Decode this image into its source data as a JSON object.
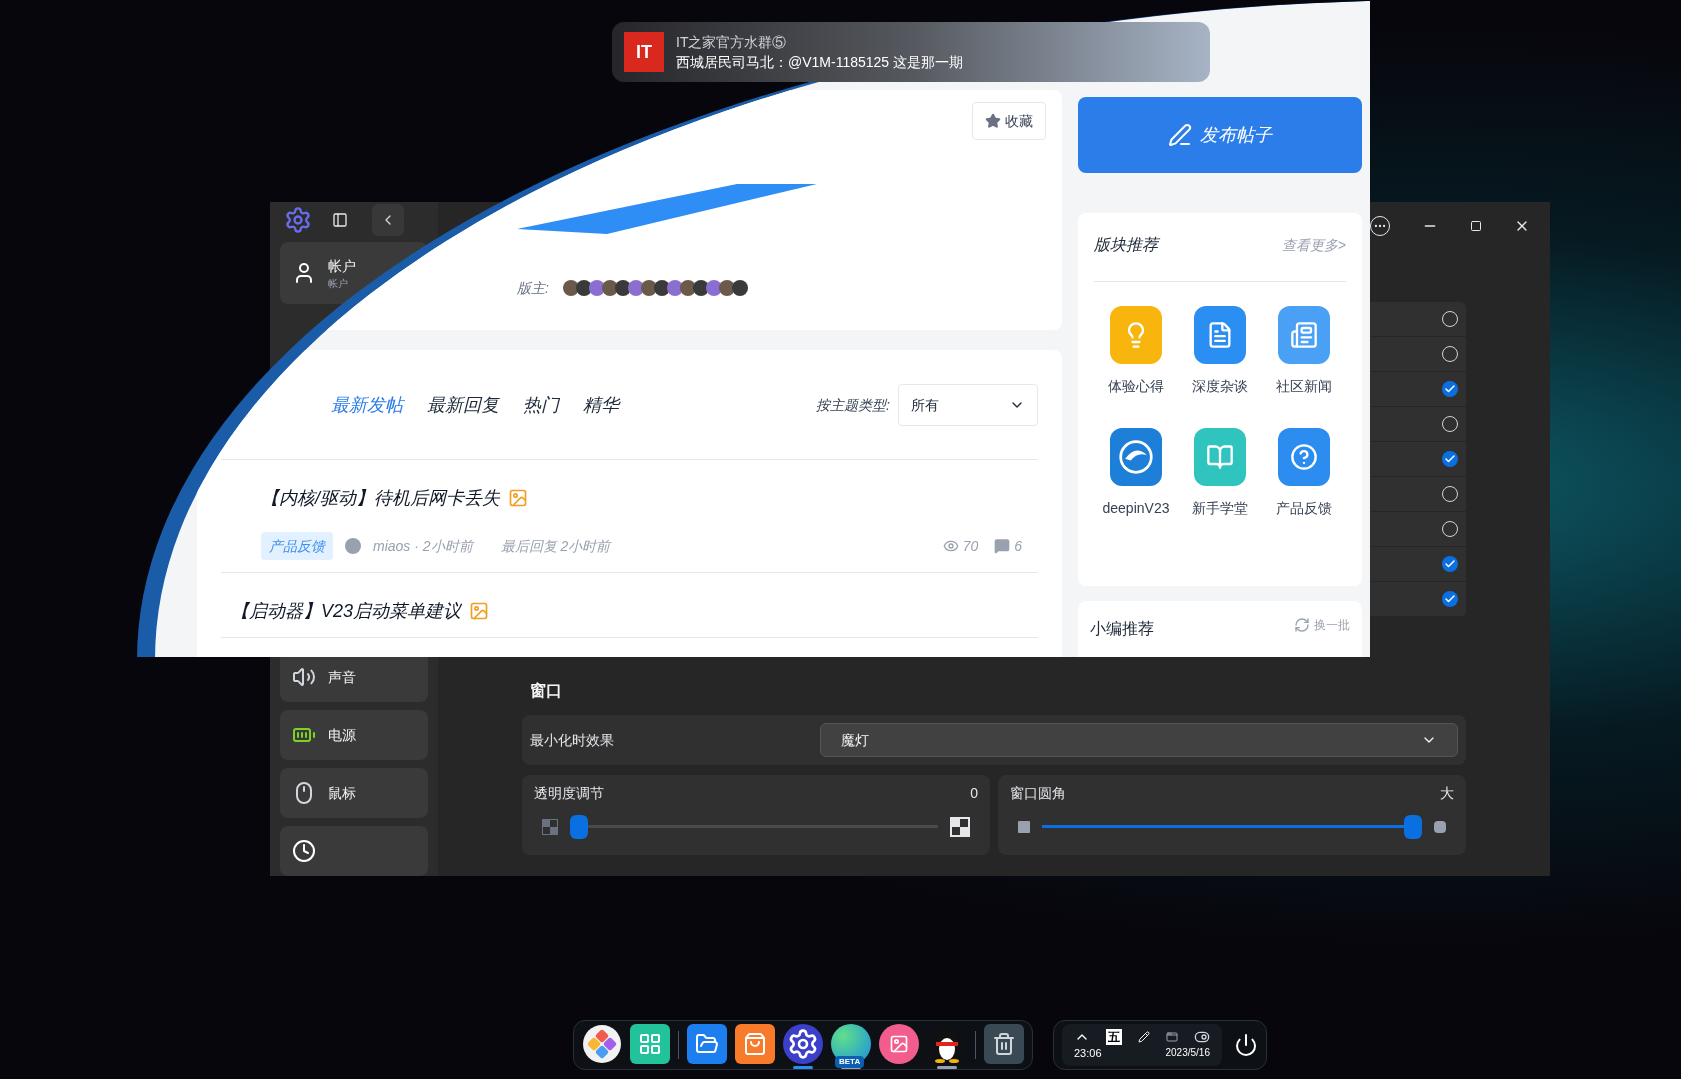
{
  "notification": {
    "icon_text": "IT",
    "title": "IT之家官方水群⑤",
    "message": "西城居民司马北：@V1M-1185125 这是那一期"
  },
  "settings_window": {
    "sidebar": [
      {
        "kind": "person",
        "label": "帐户",
        "sublabel": "帐户"
      },
      {
        "kind": "speaker",
        "label": "声音"
      },
      {
        "kind": "battery",
        "label": "电源"
      },
      {
        "kind": "mouse",
        "label": "鼠标"
      },
      {
        "kind": "clock"
      }
    ],
    "checklist": [
      {
        "checked": false
      },
      {
        "checked": false
      },
      {
        "checked": true
      },
      {
        "checked": false
      },
      {
        "checked": true
      },
      {
        "checked": false
      },
      {
        "checked": false
      },
      {
        "checked": true
      },
      {
        "checked": true
      }
    ],
    "section": {
      "title": "窗口",
      "minimize_effect": {
        "label": "最小化时效果",
        "value": "魔灯"
      },
      "sliders": [
        {
          "kind": "opacity",
          "label": "透明度调节",
          "reading": "0",
          "level": 0
        },
        {
          "kind": "radius",
          "label": "窗口圆角",
          "reading": "大",
          "level": 1
        }
      ]
    }
  },
  "forum": {
    "post_button": "发布帖子",
    "favorite_button": "收藏",
    "moderators_label": "版主:",
    "tabs": [
      {
        "label": "最新发帖",
        "selected": true
      },
      {
        "label": "最新回复",
        "selected": false
      },
      {
        "label": "热门",
        "selected": false
      },
      {
        "label": "精华",
        "selected": false
      }
    ],
    "filter": {
      "label": "按主题类型:",
      "value": "所有"
    },
    "posts": [
      {
        "title": "【内核/驱动】待机后网卡丢失",
        "tag": "产品反馈",
        "author": "miaos · 2小时前",
        "last_reply": "最后回复 2小时前",
        "views": "70",
        "comments": "6"
      },
      {
        "title": "【启动器】V23启动菜单建议"
      }
    ],
    "boards": {
      "title": "版块推荐",
      "more": "查看更多>",
      "items": [
        {
          "kind": "bulb",
          "label": "体验心得",
          "color": "#f7b50e"
        },
        {
          "kind": "chat",
          "label": "深度杂谈",
          "color": "#2b8ef2"
        },
        {
          "kind": "news",
          "label": "社区新闻",
          "color": "#4aa0f4"
        },
        {
          "kind": "logo",
          "label": "deepinV23",
          "color": "#1e7fd8"
        },
        {
          "kind": "book",
          "label": "新手学堂",
          "color": "#2fc4bd"
        },
        {
          "kind": "help",
          "label": "产品反馈",
          "color": "#2d8cf0"
        }
      ]
    },
    "editor_picks": {
      "title": "小编推荐",
      "action": "换一批"
    }
  },
  "dock": {
    "apps": [
      {
        "kind": "launcher",
        "running": false,
        "focused": false
      },
      {
        "kind": "terminal",
        "running": false,
        "focused": false
      },
      {
        "kind": "files",
        "running": false,
        "focused": false
      },
      {
        "kind": "store",
        "running": false,
        "focused": false
      },
      {
        "kind": "settings",
        "running": true,
        "focused": true
      },
      {
        "kind": "browser",
        "badge": "BETA",
        "running": true,
        "focused": false
      },
      {
        "kind": "video",
        "running": false,
        "focused": false
      },
      {
        "kind": "penguin",
        "running": true,
        "focused": false
      },
      {
        "kind": "trash",
        "running": false,
        "focused": false
      }
    ],
    "tray": {
      "input_method": "五",
      "time": "23:06",
      "date": "2023/5/16"
    }
  }
}
